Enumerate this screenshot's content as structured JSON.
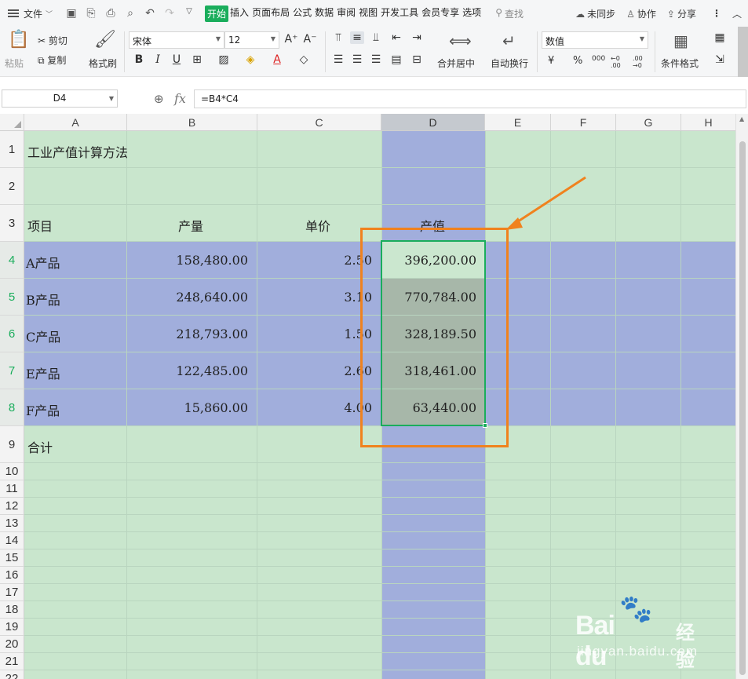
{
  "menubar": {
    "file_label": "文件",
    "tabs": [
      "开始",
      "插入",
      "页面布局",
      "公式",
      "数据",
      "审阅",
      "视图",
      "开发工具",
      "会员专享",
      "选项"
    ],
    "active_tab": "开始",
    "search_label": "查找",
    "right": {
      "sync_label": "未同步",
      "collab_label": "协作",
      "share_label": "分享"
    }
  },
  "ribbon": {
    "paste_label": "粘贴",
    "cut_label": "剪切",
    "copy_label": "复制",
    "format_painter_label": "格式刷",
    "font_name": "宋体",
    "font_size": "12",
    "merge_label": "合并居中",
    "wrap_label": "自动换行",
    "number_format": "数值",
    "cond_format_label": "条件格式",
    "percent_label": "%",
    "thousands_label": "000",
    "dec_inc_label": "←0 .00",
    "dec_dec_label": ".00 →0",
    "currency_label": "¥"
  },
  "formula_bar": {
    "cell_ref": "D4",
    "fx_label": "fx",
    "formula": "=B4*C4"
  },
  "sheet": {
    "columns": [
      "A",
      "B",
      "C",
      "D",
      "E",
      "F",
      "G",
      "H"
    ],
    "selected_column": "D",
    "rows": [
      "1",
      "2",
      "3",
      "4",
      "5",
      "6",
      "7",
      "8",
      "9",
      "10",
      "11",
      "12",
      "13",
      "14",
      "15",
      "16",
      "17",
      "18",
      "19",
      "20",
      "21",
      "22"
    ],
    "title": "工业产值计算方法",
    "headers": {
      "item": "项目",
      "qty": "产量",
      "price": "单价",
      "value": "产值"
    },
    "data": [
      {
        "item": "A产品",
        "qty": "158,480.00",
        "price": "2.50",
        "value": "396,200.00"
      },
      {
        "item": "B产品",
        "qty": "248,640.00",
        "price": "3.10",
        "value": "770,784.00"
      },
      {
        "item": "C产品",
        "qty": "218,793.00",
        "price": "1.50",
        "value": "328,189.50"
      },
      {
        "item": "E产品",
        "qty": "122,485.00",
        "price": "2.60",
        "value": "318,461.00"
      },
      {
        "item": "F产品",
        "qty": "15,860.00",
        "price": "4.00",
        "value": "63,440.00"
      }
    ],
    "total_label": "合计"
  },
  "watermark": {
    "logo": "Bai du",
    "cn": "经验",
    "url": "jingyan.baidu.com"
  },
  "colors": {
    "accent": "#1aad5c",
    "highlight_band": "#a1aedc",
    "sheet_bg": "#c9e6cd",
    "annotation": "#f0821e"
  }
}
